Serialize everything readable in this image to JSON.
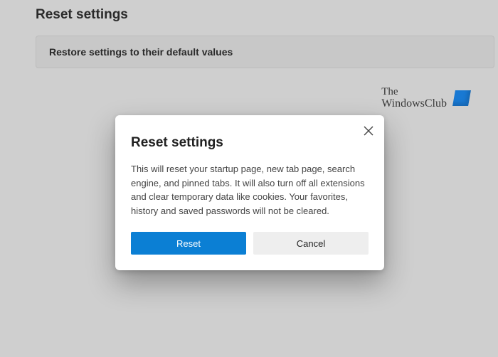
{
  "page": {
    "title": "Reset settings",
    "restore_label": "Restore settings to their default values"
  },
  "watermark": {
    "line1": "The",
    "line2": "WindowsClub"
  },
  "dialog": {
    "title": "Reset settings",
    "body": "This will reset your startup page, new tab page, search engine, and pinned tabs. It will also turn off all extensions and clear temporary data like cookies. Your favorites, history and saved passwords will not be cleared.",
    "reset_label": "Reset",
    "cancel_label": "Cancel"
  }
}
